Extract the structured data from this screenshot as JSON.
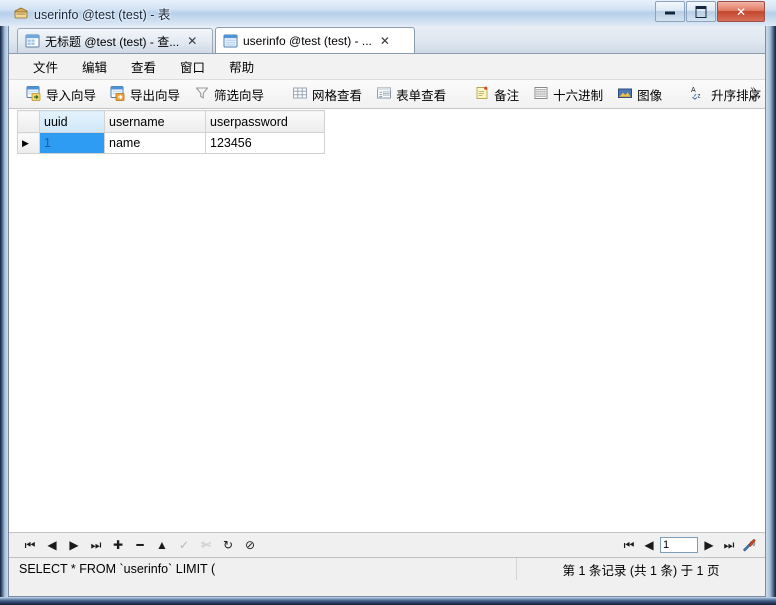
{
  "window": {
    "title": "userinfo @test (test) - 表",
    "icon": "table-window-icon",
    "buttons": {
      "minimize": "minimize-button",
      "maximize": "maximize-button",
      "close": "✕"
    }
  },
  "tabs": [
    {
      "label": "无标题 @test (test) - 查...",
      "icon": "query-tab-icon",
      "close": "✕",
      "active": false
    },
    {
      "label": "userinfo @test (test) - ...",
      "icon": "table-tab-icon",
      "close": "✕",
      "active": true
    }
  ],
  "menu": {
    "items": [
      "文件",
      "编辑",
      "查看",
      "窗口",
      "帮助"
    ]
  },
  "toolbar": {
    "groups": [
      [
        {
          "label": "导入向导",
          "icon": "import-wizard-icon"
        },
        {
          "label": "导出向导",
          "icon": "export-wizard-icon"
        },
        {
          "label": "筛选向导",
          "icon": "filter-wizard-icon"
        }
      ],
      [
        {
          "label": "网格查看",
          "icon": "grid-view-icon"
        },
        {
          "label": "表单查看",
          "icon": "form-view-icon"
        }
      ],
      [
        {
          "label": "备注",
          "icon": "memo-icon"
        },
        {
          "label": "十六进制",
          "icon": "hex-icon"
        },
        {
          "label": "图像",
          "icon": "image-icon"
        }
      ],
      [
        {
          "label": "升序排序",
          "icon": "sort-ascending-icon"
        }
      ]
    ],
    "overflow": {
      "chevrons": "»",
      "arrow": "▾"
    }
  },
  "grid": {
    "columns": [
      {
        "key": "uuid",
        "label": "uuid",
        "selected": true
      },
      {
        "key": "username",
        "label": "username",
        "selected": false
      },
      {
        "key": "userpassword",
        "label": "userpassword",
        "selected": false
      }
    ],
    "rows": [
      {
        "indicator": "▶",
        "cells": [
          {
            "value": "1",
            "selected": true
          },
          {
            "value": "name",
            "selected": false
          },
          {
            "value": "123456",
            "selected": false
          }
        ]
      }
    ]
  },
  "record_nav": {
    "buttons": [
      {
        "name": "first-record",
        "glyph": "⏮",
        "enabled": true
      },
      {
        "name": "previous-record",
        "glyph": "◀",
        "enabled": true
      },
      {
        "name": "next-record",
        "glyph": "▶",
        "enabled": true
      },
      {
        "name": "last-record",
        "glyph": "⏭",
        "enabled": true
      },
      {
        "name": "add-record",
        "glyph": "✚",
        "enabled": true
      },
      {
        "name": "delete-record",
        "glyph": "━",
        "enabled": true
      },
      {
        "name": "apply-change",
        "glyph": "▲",
        "enabled": true
      },
      {
        "name": "confirm-edit",
        "glyph": "✓",
        "enabled": false
      },
      {
        "name": "cancel-edit",
        "glyph": "✄",
        "enabled": false
      },
      {
        "name": "refresh",
        "glyph": "↻",
        "enabled": true
      },
      {
        "name": "stop",
        "glyph": "⊘",
        "enabled": true
      }
    ]
  },
  "pager": {
    "first": "⏮",
    "previous": "◀",
    "page_value": "1",
    "next": "▶",
    "last": "⏭",
    "tools_icon": "tools-icon"
  },
  "status": {
    "sql": "SELECT * FROM `userinfo` LIMIT (",
    "record_info": "第 1 条记录 (共 1 条) 于 1 页"
  },
  "colors": {
    "selection_blue": "#2f9cf4",
    "header_selected": "#cfe8fa",
    "close_button_red": "#c2462c",
    "frame_blue": "#11203a"
  }
}
